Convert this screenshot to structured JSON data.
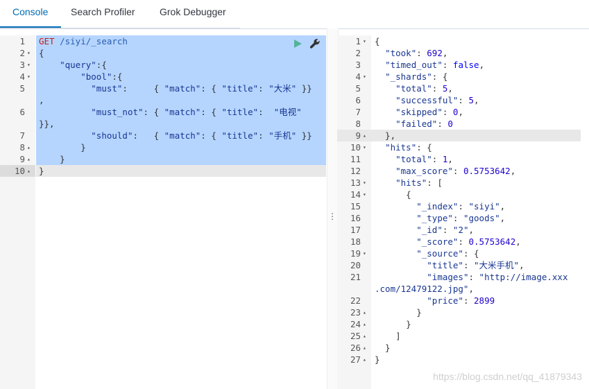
{
  "tabs": [
    {
      "label": "Console"
    },
    {
      "label": "Search Profiler"
    },
    {
      "label": "Grok Debugger"
    }
  ],
  "request": {
    "lines": [
      {
        "n": "1",
        "fold": "",
        "html": "<span class='k'>GET</span> <span class='url'>/siyi/_search</span>"
      },
      {
        "n": "2",
        "fold": "▾",
        "html": "{"
      },
      {
        "n": "3",
        "fold": "▾",
        "html": "    <span class='key'>\"query\"</span>:{"
      },
      {
        "n": "4",
        "fold": "▾",
        "html": "        <span class='key'>\"bool\"</span>:{"
      },
      {
        "n": "5",
        "fold": "",
        "html": "          <span class='key'>\"must\"</span>:     { <span class='key'>\"match\"</span>: { <span class='key'>\"title\"</span>: <span class='str'>\"大米\"</span> }}"
      },
      {
        "n": "",
        "fold": "",
        "html": ","
      },
      {
        "n": "6",
        "fold": "",
        "html": "          <span class='key'>\"must_not\"</span>: { <span class='key'>\"match\"</span>: { <span class='key'>\"title\"</span>:  <span class='str'>\"电视\"</span>"
      },
      {
        "n": "",
        "fold": "",
        "html": "}},"
      },
      {
        "n": "7",
        "fold": "",
        "html": "          <span class='key'>\"should\"</span>:   { <span class='key'>\"match\"</span>: { <span class='key'>\"title\"</span>: <span class='str'>\"手机\"</span> }}"
      },
      {
        "n": "8",
        "fold": "▴",
        "html": "        }"
      },
      {
        "n": "9",
        "fold": "▴",
        "html": "    }"
      },
      {
        "n": "10",
        "fold": "▴",
        "html": "}"
      }
    ]
  },
  "response": {
    "lines": [
      {
        "n": "1",
        "fold": "▾",
        "html": "{"
      },
      {
        "n": "2",
        "fold": "",
        "html": "  <span class='key'>\"took\"</span>: <span class='num'>692</span>,"
      },
      {
        "n": "3",
        "fold": "",
        "html": "  <span class='key'>\"timed_out\"</span>: <span class='bool'>false</span>,"
      },
      {
        "n": "4",
        "fold": "▾",
        "html": "  <span class='key'>\"_shards\"</span>: {"
      },
      {
        "n": "5",
        "fold": "",
        "html": "    <span class='key'>\"total\"</span>: <span class='num'>5</span>,"
      },
      {
        "n": "6",
        "fold": "",
        "html": "    <span class='key'>\"successful\"</span>: <span class='num'>5</span>,"
      },
      {
        "n": "7",
        "fold": "",
        "html": "    <span class='key'>\"skipped\"</span>: <span class='num'>0</span>,"
      },
      {
        "n": "8",
        "fold": "",
        "html": "    <span class='key'>\"failed\"</span>: <span class='num'>0</span>"
      },
      {
        "n": "9",
        "fold": "▴",
        "html": "  },"
      },
      {
        "n": "10",
        "fold": "▾",
        "html": "  <span class='key'>\"hits\"</span>: {"
      },
      {
        "n": "11",
        "fold": "",
        "html": "    <span class='key'>\"total\"</span>: <span class='num'>1</span>,"
      },
      {
        "n": "12",
        "fold": "",
        "html": "    <span class='key'>\"max_score\"</span>: <span class='num'>0.5753642</span>,"
      },
      {
        "n": "13",
        "fold": "▾",
        "html": "    <span class='key'>\"hits\"</span>: ["
      },
      {
        "n": "14",
        "fold": "▾",
        "html": "      {"
      },
      {
        "n": "15",
        "fold": "",
        "html": "        <span class='key'>\"_index\"</span>: <span class='str'>\"siyi\"</span>,"
      },
      {
        "n": "16",
        "fold": "",
        "html": "        <span class='key'>\"_type\"</span>: <span class='str'>\"goods\"</span>,"
      },
      {
        "n": "17",
        "fold": "",
        "html": "        <span class='key'>\"_id\"</span>: <span class='str'>\"2\"</span>,"
      },
      {
        "n": "18",
        "fold": "",
        "html": "        <span class='key'>\"_score\"</span>: <span class='num'>0.5753642</span>,"
      },
      {
        "n": "19",
        "fold": "▾",
        "html": "        <span class='key'>\"_source\"</span>: {"
      },
      {
        "n": "20",
        "fold": "",
        "html": "          <span class='key'>\"title\"</span>: <span class='str'>\"大米手机\"</span>,"
      },
      {
        "n": "21",
        "fold": "",
        "html": "          <span class='key'>\"images\"</span>: <span class='str'>\"http://image.xxx</span>"
      },
      {
        "n": "",
        "fold": "",
        "html": "<span class='str'>.com/12479122.jpg\"</span>,"
      },
      {
        "n": "22",
        "fold": "",
        "html": "          <span class='key'>\"price\"</span>: <span class='num'>2899</span>"
      },
      {
        "n": "23",
        "fold": "▴",
        "html": "        }"
      },
      {
        "n": "24",
        "fold": "▴",
        "html": "      }"
      },
      {
        "n": "25",
        "fold": "▴",
        "html": "    ]"
      },
      {
        "n": "26",
        "fold": "▴",
        "html": "  }"
      },
      {
        "n": "27",
        "fold": "▴",
        "html": "}"
      }
    ]
  },
  "icons": {
    "play": "play-icon",
    "wrench": "wrench-icon",
    "splitter": "resize-handle-icon"
  },
  "colors": {
    "accent": "#006bb4",
    "selection": "#b5d5ff",
    "play": "#54b399"
  },
  "watermark": "https://blog.csdn.net/qq_41879343"
}
